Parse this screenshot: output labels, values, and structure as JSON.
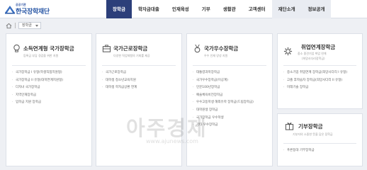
{
  "header": {
    "logo_small": "공공기관",
    "logo_text": "한국장학재단",
    "nav": [
      "장학금",
      "학자금대출",
      "인재육성",
      "기부",
      "생활관",
      "고객센터",
      "재단소개",
      "정보공개"
    ]
  },
  "breadcrumb": {
    "selected": "장학금"
  },
  "cards": {
    "c1": {
      "title": "소득연계형 국가장학금",
      "subtitle": "등록금 부담 경감을 위한 지원",
      "items": [
        "국가장학금 I 유형(학생직접지원형)",
        "국가장학금 II 유형(대학연계지원형)",
        "다자녀 국가장학금",
        "지역인재장학금",
        "입학금 지원 장학금"
      ]
    },
    "c2": {
      "title": "국가근로장학금",
      "subtitle": "다양한 직업체험의 기회를 제공",
      "items": [
        "국가근로장학금",
        "대학생 청소년교육지원",
        "대학생 학자금상환 연계"
      ]
    },
    "c3": {
      "title": "국가우수장학금",
      "subtitle": "우수 인재 양성 지원",
      "items": [
        "대통령과학장학금",
        "국가우수장학금(이공계)",
        "인문100년장학금",
        "예술체육비전장학금",
        "우수고등학생 해외유학 장학금(드림장학금)",
        "대학원생 장학금",
        "국가장학금 우수학생",
        "기타 우수장학금"
      ]
    },
    "c4": {
      "title": "취업연계장학금",
      "subtitle": "중소 중견기업 취업 연계",
      "subtitle2": "(희망사다리장학금)",
      "items": [
        "중소기업 취업연계 장학금(희망사다리 I 유형)",
        "고졸 후학습자 장학금(희망사다리 II 유형)",
        "미래기술 장학금"
      ]
    },
    "c5": {
      "title": "기부장학금",
      "subtitle": "기부자의 소중한 뜻을 담은 장학금",
      "items": [
        "푸른등대 기부장학금"
      ]
    }
  },
  "watermark": "아주경제",
  "watermark_url": "www.ajunews.com"
}
